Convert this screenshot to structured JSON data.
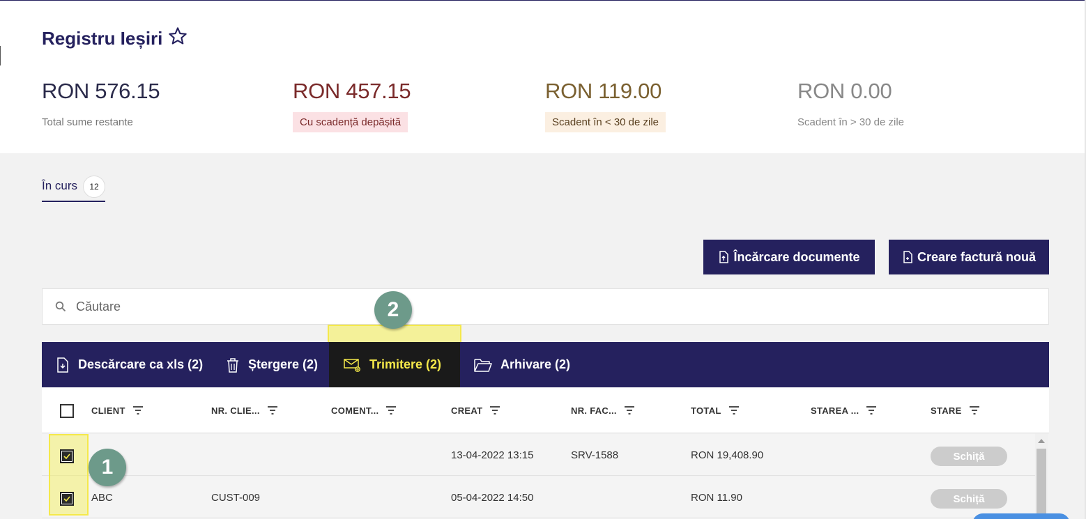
{
  "page": {
    "title": "Registru Ieșiri"
  },
  "stats": [
    {
      "amount": "RON 576.15",
      "label": "Total sume restante",
      "color": "#2a2a4a",
      "label_bg": "",
      "label_color": "#777777"
    },
    {
      "amount": "RON 457.15",
      "label": "Cu scadență depășită",
      "color": "#7a2a2a",
      "label_bg": "#fbe1e4",
      "label_color": "#7a2a2a"
    },
    {
      "amount": "RON 119.00",
      "label": "Scadent în < 30 de zile",
      "color": "#7a6030",
      "label_bg": "#fbefe1",
      "label_color": "#5a4020"
    },
    {
      "amount": "RON 0.00",
      "label": "Scadent în > 30 de zile",
      "color": "#888888",
      "label_bg": "",
      "label_color": "#888888"
    }
  ],
  "tabs": [
    {
      "label": "În curs",
      "count": "12"
    }
  ],
  "actions": {
    "upload_label": "Încărcare documente",
    "create_label": "Creare factură nouă"
  },
  "search": {
    "placeholder": "Căutare"
  },
  "toolbar": {
    "download_label": "Descărcare ca xls (2)",
    "delete_label": "Ștergere (2)",
    "send_label": "Trimitere (2)",
    "archive_label": "Arhivare (2)"
  },
  "annotations": {
    "step1": "1",
    "step2": "2"
  },
  "table": {
    "columns": [
      "CLIENT",
      "NR. CLIE...",
      "COMENT...",
      "CREAT",
      "NR. FAC...",
      "TOTAL",
      "STAREA ...",
      "STARE"
    ],
    "rows": [
      {
        "client": "",
        "client_no": "",
        "comment": "",
        "created": "13-04-2022 13:15",
        "invoice_no": "SRV-1588",
        "total": "RON 19,408.90",
        "state_detail": "",
        "status": "Schiță",
        "checked": true
      },
      {
        "client": "ABC",
        "client_no": "CUST-009",
        "comment": "",
        "created": "05-04-2022 14:50",
        "invoice_no": "",
        "total": "RON 11.90",
        "state_detail": "",
        "status": "Schiță",
        "checked": true
      }
    ]
  },
  "colors": {
    "primary": "#25215e",
    "highlight": "#f5e94a",
    "step_badge": "#6d9a8a",
    "pill": "#cccccc"
  }
}
